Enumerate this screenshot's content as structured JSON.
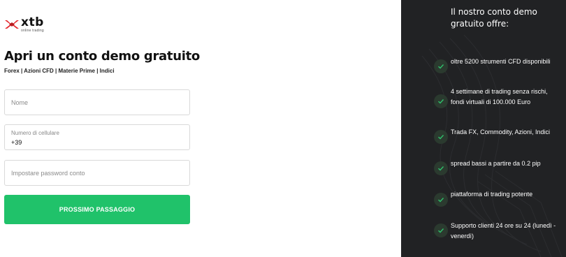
{
  "brand": {
    "name": "xtb",
    "tagline": "online trading"
  },
  "form": {
    "title": "Apri un conto demo gratuito",
    "subtitle": "Forex | Azioni CFD | Materie Prime | Indici",
    "name_placeholder": "Nome",
    "phone_label": "Numero di cellulare",
    "phone_prefix": "+39",
    "password_placeholder": "Impostare password conto",
    "submit_label": "PROSSIMO PASSAGGIO"
  },
  "benefits": {
    "heading": "Il nostro conto demo gratuito offre:",
    "items": [
      "oltre 5200 strumenti CFD disponibili",
      "4 settimane di trading senza rischi, fondi virtuali di 100.000 Euro",
      "Trada FX, Commodity, Azioni, Indici",
      "spread bassi a partire da 0.2 pip",
      "piattaforma di trading potente",
      "Supporto clienti 24 ore su 24 (lunedì - venerdì)"
    ]
  },
  "colors": {
    "accent_green": "#20c26a",
    "brand_red": "#e5262b",
    "panel_dark": "#212224",
    "check_green": "#2fbf6b"
  }
}
